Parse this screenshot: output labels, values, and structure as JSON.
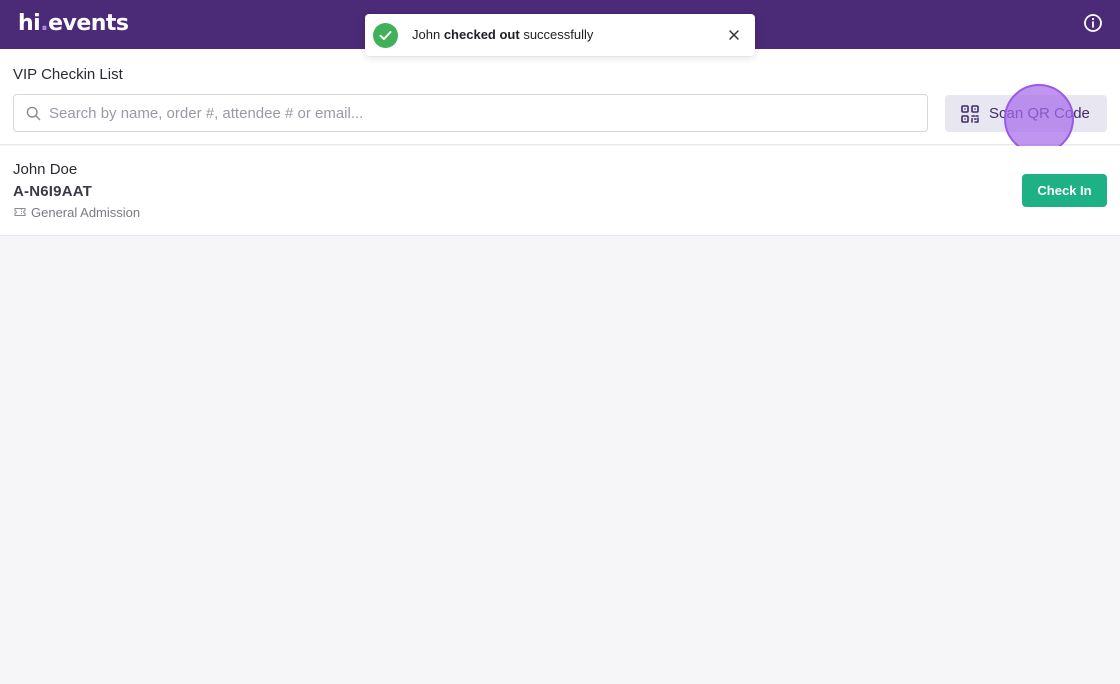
{
  "app": {
    "logo_main": "hi",
    "logo_dot": ".",
    "logo_rest": "events",
    "brand_color": "#4b2a78"
  },
  "toast": {
    "prefix": "John",
    "emphasis": "checked out",
    "suffix": "successfully",
    "status": "success",
    "icon": "check-circle-icon",
    "status_color": "#40b15a"
  },
  "checkin_list": {
    "title": "VIP Checkin List",
    "search_placeholder": "Search by name, order #, attendee # or email...",
    "search_value": "",
    "scan_button_label": "Scan QR Code"
  },
  "attendees": [
    {
      "name": "John Doe",
      "attendee_id": "A-N6I9AAT",
      "ticket_type": "General Admission",
      "action_label": "Check In",
      "action_color": "#1db185"
    }
  ]
}
